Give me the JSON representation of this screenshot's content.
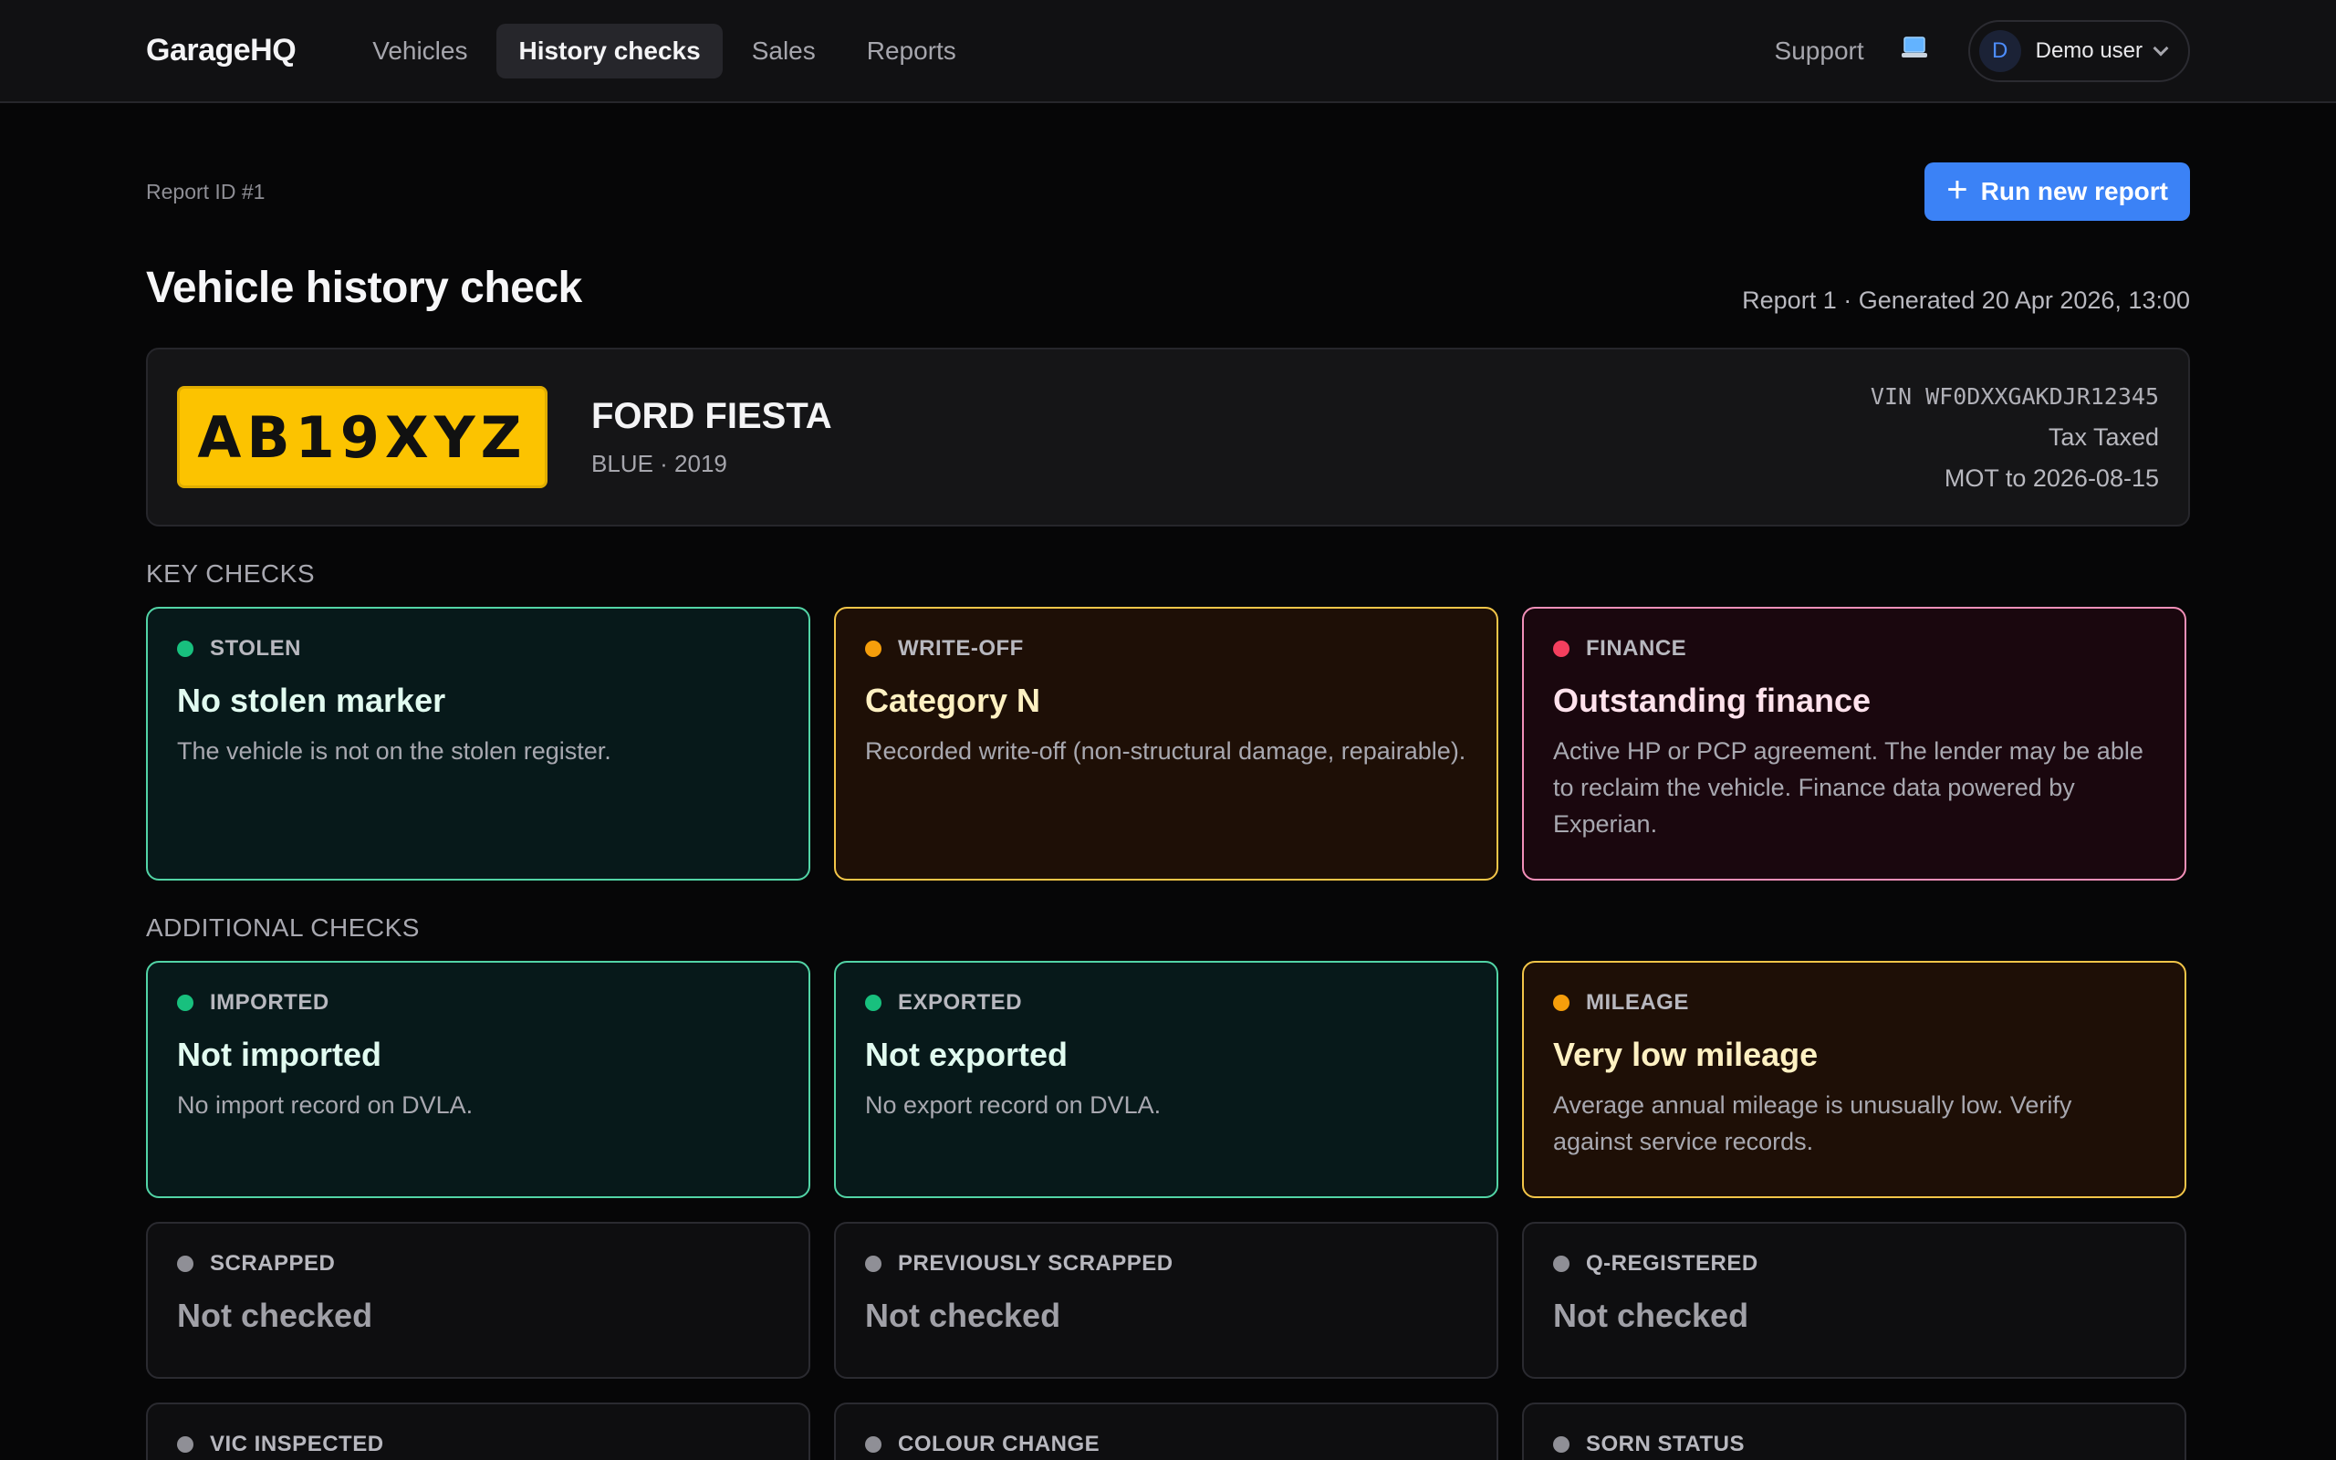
{
  "nav": {
    "brand": "GarageHQ",
    "tabs": [
      {
        "label": "Vehicles"
      },
      {
        "label": "History checks",
        "active": true
      },
      {
        "label": "Sales"
      },
      {
        "label": "Reports"
      }
    ],
    "support": "Support",
    "laptop_icon": "laptop-icon",
    "user": {
      "initial": "D",
      "name": "Demo user"
    }
  },
  "header": {
    "report_id": "Report ID #1",
    "run_button": "Run new report",
    "title": "Vehicle history check",
    "generated": "Report 1 · Generated 20 Apr 2026, 13:00"
  },
  "vehicle": {
    "plate": "AB19XYZ",
    "model": "FORD FIESTA",
    "sub": "BLUE · 2019",
    "vin": "VIN WF0DXXGAKDJR12345",
    "tax": "Tax Taxed",
    "mot": "MOT to 2026-08-15"
  },
  "sections": {
    "key": "KEY CHECKS",
    "additional": "ADDITIONAL CHECKS"
  },
  "key_checks": [
    {
      "label": "STOLEN",
      "title": "No stolen marker",
      "desc": "The vehicle is not on the stolen register.",
      "status": "ok"
    },
    {
      "label": "WRITE-OFF",
      "title": "Category N",
      "desc": "Recorded write-off (non-structural damage, repairable).",
      "status": "warn"
    },
    {
      "label": "FINANCE",
      "title": "Outstanding finance",
      "desc": "Active HP or PCP agreement. The lender may be able to reclaim the vehicle. Finance data powered by Experian.",
      "status": "bad"
    }
  ],
  "additional_checks": [
    {
      "label": "IMPORTED",
      "title": "Not imported",
      "desc": "No import record on DVLA.",
      "status": "ok"
    },
    {
      "label": "EXPORTED",
      "title": "Not exported",
      "desc": "No export record on DVLA.",
      "status": "ok"
    },
    {
      "label": "MILEAGE",
      "title": "Very low mileage",
      "desc": "Average annual mileage is unusually low. Verify against service records.",
      "status": "warn"
    }
  ],
  "muted_checks": [
    {
      "label": "SCRAPPED",
      "title": "Not checked"
    },
    {
      "label": "PREVIOUSLY SCRAPPED",
      "title": "Not checked"
    },
    {
      "label": "Q-REGISTERED",
      "title": "Not checked"
    }
  ],
  "bottom_checks": [
    {
      "label": "VIC INSPECTED"
    },
    {
      "label": "COLOUR CHANGE"
    },
    {
      "label": "SORN STATUS"
    }
  ]
}
